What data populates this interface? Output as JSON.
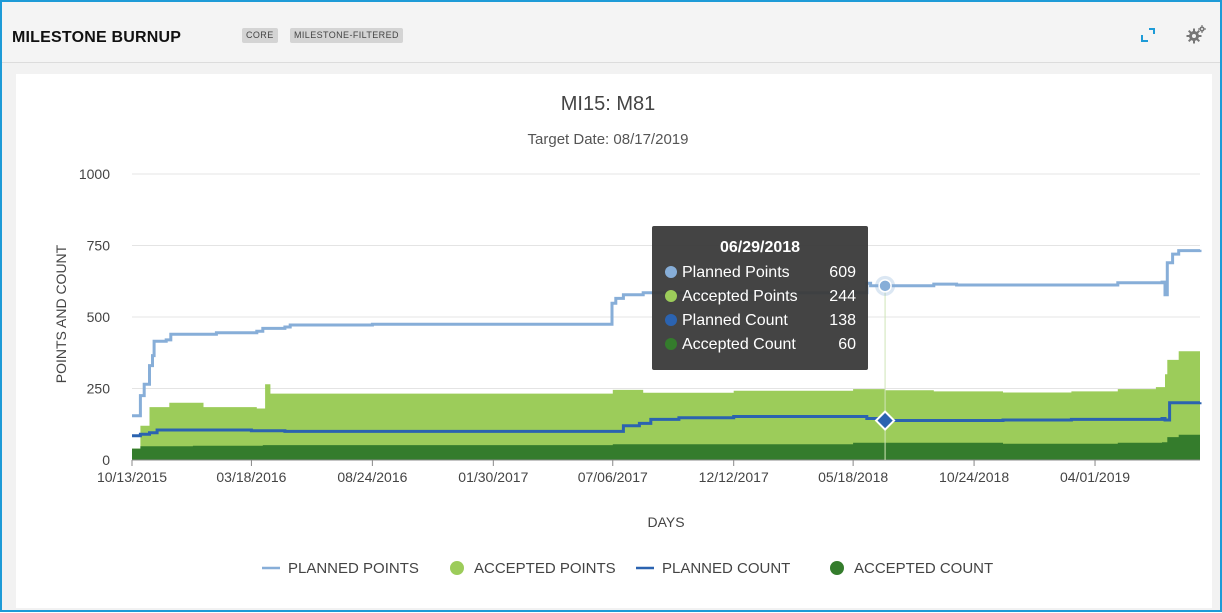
{
  "header": {
    "title": "MILESTONE BURNUP",
    "tags": [
      "CORE",
      "MILESTONE-FILTERED"
    ],
    "expand_icon": "expand-icon",
    "settings_icon": "gear-icon"
  },
  "colors": {
    "planned_points": "#87aed8",
    "accepted_points": "#9ccc5a",
    "planned_count": "#2b63b0",
    "accepted_count": "#347c2c",
    "frame": "#1e9bd7"
  },
  "tooltip": {
    "date": "06/29/2018",
    "rows": [
      {
        "label": "Planned Points",
        "value": "609"
      },
      {
        "label": "Accepted Points",
        "value": "244"
      },
      {
        "label": "Planned Count",
        "value": "138"
      },
      {
        "label": "Accepted Count",
        "value": "60"
      }
    ]
  },
  "chart_data": {
    "type": "area",
    "title": "MI15: M81",
    "subtitle": "Target Date: 08/17/2019",
    "xlabel": "DAYS",
    "ylabel": "POINTS AND COUNT",
    "ylim": [
      0,
      1000
    ],
    "yticks": [
      0,
      250,
      500,
      750,
      1000
    ],
    "xlim": [
      "2015-10-13",
      "2019-08-17"
    ],
    "xticks": [
      {
        "date": "2015-10-13",
        "label": "10/13/2015"
      },
      {
        "date": "2016-03-18",
        "label": "03/18/2016"
      },
      {
        "date": "2016-08-24",
        "label": "08/24/2016"
      },
      {
        "date": "2017-01-30",
        "label": "01/30/2017"
      },
      {
        "date": "2017-07-06",
        "label": "07/06/2017"
      },
      {
        "date": "2017-12-12",
        "label": "12/12/2017"
      },
      {
        "date": "2018-05-18",
        "label": "05/18/2018"
      },
      {
        "date": "2018-10-24",
        "label": "10/24/2018"
      },
      {
        "date": "2019-04-01",
        "label": "04/01/2019"
      }
    ],
    "grid": true,
    "legend_position": "bottom",
    "series": [
      {
        "name": "PLANNED POINTS",
        "kind": "line",
        "points": [
          [
            "2015-10-13",
            155
          ],
          [
            "2015-10-22",
            155
          ],
          [
            "2015-10-24",
            225
          ],
          [
            "2015-10-29",
            265
          ],
          [
            "2015-11-05",
            330
          ],
          [
            "2015-11-09",
            365
          ],
          [
            "2015-11-11",
            415
          ],
          [
            "2015-11-27",
            420
          ],
          [
            "2015-12-03",
            440
          ],
          [
            "2016-02-01",
            445
          ],
          [
            "2016-03-25",
            450
          ],
          [
            "2016-04-02",
            460
          ],
          [
            "2016-05-01",
            465
          ],
          [
            "2016-05-08",
            472
          ],
          [
            "2016-08-24",
            475
          ],
          [
            "2017-06-30",
            475
          ],
          [
            "2017-07-05",
            548
          ],
          [
            "2017-07-10",
            565
          ],
          [
            "2017-07-20",
            578
          ],
          [
            "2017-08-15",
            585
          ],
          [
            "2018-06-05",
            618
          ],
          [
            "2018-06-10",
            609
          ],
          [
            "2018-06-29",
            609
          ],
          [
            "2018-09-01",
            615
          ],
          [
            "2018-10-01",
            612
          ],
          [
            "2019-02-01",
            612
          ],
          [
            "2019-04-01",
            612
          ],
          [
            "2019-05-01",
            620
          ],
          [
            "2019-06-28",
            622
          ],
          [
            "2019-07-02",
            578
          ],
          [
            "2019-07-05",
            690
          ],
          [
            "2019-07-12",
            720
          ],
          [
            "2019-07-20",
            732
          ],
          [
            "2019-08-17",
            735
          ]
        ]
      },
      {
        "name": "ACCEPTED POINTS",
        "kind": "area",
        "points": [
          [
            "2015-10-13",
            40
          ],
          [
            "2015-10-24",
            120
          ],
          [
            "2015-11-05",
            185
          ],
          [
            "2015-12-01",
            200
          ],
          [
            "2016-01-15",
            185
          ],
          [
            "2016-03-25",
            180
          ],
          [
            "2016-04-05",
            265
          ],
          [
            "2016-04-12",
            232
          ],
          [
            "2016-08-24",
            232
          ],
          [
            "2017-01-30",
            232
          ],
          [
            "2017-07-06",
            245
          ],
          [
            "2017-08-15",
            235
          ],
          [
            "2017-12-12",
            242
          ],
          [
            "2018-05-18",
            248
          ],
          [
            "2018-06-29",
            244
          ],
          [
            "2018-09-01",
            240
          ],
          [
            "2018-12-01",
            236
          ],
          [
            "2019-03-01",
            240
          ],
          [
            "2019-05-01",
            248
          ],
          [
            "2019-06-20",
            255
          ],
          [
            "2019-07-02",
            300
          ],
          [
            "2019-07-05",
            350
          ],
          [
            "2019-07-20",
            380
          ],
          [
            "2019-08-17",
            395
          ]
        ]
      },
      {
        "name": "PLANNED COUNT",
        "kind": "line",
        "points": [
          [
            "2015-10-13",
            85
          ],
          [
            "2015-10-24",
            90
          ],
          [
            "2015-11-05",
            95
          ],
          [
            "2015-11-15",
            105
          ],
          [
            "2016-03-18",
            102
          ],
          [
            "2016-05-01",
            100
          ],
          [
            "2016-08-24",
            100
          ],
          [
            "2017-01-30",
            100
          ],
          [
            "2017-07-06",
            100
          ],
          [
            "2017-07-20",
            120
          ],
          [
            "2017-08-10",
            128
          ],
          [
            "2017-08-25",
            142
          ],
          [
            "2017-10-01",
            148
          ],
          [
            "2017-12-12",
            152
          ],
          [
            "2018-05-18",
            152
          ],
          [
            "2018-06-05",
            145
          ],
          [
            "2018-06-29",
            138
          ],
          [
            "2018-09-01",
            138
          ],
          [
            "2018-12-01",
            140
          ],
          [
            "2019-03-01",
            142
          ],
          [
            "2019-06-28",
            145
          ],
          [
            "2019-07-02",
            140
          ],
          [
            "2019-07-08",
            200
          ],
          [
            "2019-08-17",
            202
          ]
        ]
      },
      {
        "name": "ACCEPTED COUNT",
        "kind": "area",
        "points": [
          [
            "2015-10-13",
            40
          ],
          [
            "2015-10-24",
            48
          ],
          [
            "2016-01-01",
            50
          ],
          [
            "2016-04-02",
            52
          ],
          [
            "2016-08-24",
            52
          ],
          [
            "2017-01-30",
            52
          ],
          [
            "2017-07-06",
            55
          ],
          [
            "2017-12-12",
            55
          ],
          [
            "2018-05-18",
            60
          ],
          [
            "2018-06-29",
            60
          ],
          [
            "2018-12-01",
            57
          ],
          [
            "2019-05-01",
            60
          ],
          [
            "2019-06-28",
            62
          ],
          [
            "2019-07-05",
            80
          ],
          [
            "2019-07-20",
            88
          ],
          [
            "2019-08-17",
            92
          ]
        ]
      }
    ],
    "highlight": {
      "date": "2018-06-29",
      "planned_points": 609,
      "planned_count": 138
    }
  }
}
